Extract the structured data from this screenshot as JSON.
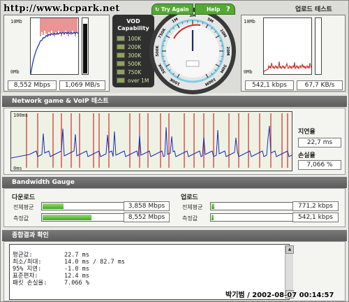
{
  "watermark": "http://www.bcpark.net",
  "download": {
    "graph_top": "10Mb",
    "graph_bottom": "0Mb",
    "speed": "8,552 Mbps",
    "rate": "1,069 MB/s"
  },
  "vod": {
    "title_1": "VOD",
    "title_2": "Capability",
    "items": [
      "100K",
      "200K",
      "300K",
      "500K",
      "750K",
      "over 1M"
    ],
    "active_count": 6
  },
  "gauge": {
    "try_again": "Try Again",
    "help": "Help",
    "help_glyph": "?",
    "scale": [
      "100K",
      "300K",
      "500K",
      "750K",
      "1M",
      "3M",
      "5M",
      "10M",
      "20M",
      "50M",
      "100M"
    ]
  },
  "upload": {
    "title": "업로드 테스트",
    "graph_top": "10Mb",
    "graph_bottom": "0Mb",
    "speed": "542,1 kbps",
    "rate": "67,7 KB/s"
  },
  "network": {
    "section_title": "Network game & VoIP 테스트",
    "axis_top": "100ms",
    "axis_bottom": "0ms",
    "latency_label": "지연율",
    "latency_value": "22,7 ms",
    "loss_label": "손실율",
    "loss_value": "7,066 %"
  },
  "bandwidth": {
    "section_title": "Bandwidth Gauge",
    "download": {
      "title": "다운로드",
      "avg_label": "전체평균",
      "avg_value": "3,858 Mbps",
      "avg_level": 0.26,
      "cur_label": "측정값",
      "cur_value": "8,552 Mbps",
      "cur_level": 0.58
    },
    "upload": {
      "title": "업로드",
      "avg_label": "전체평균",
      "avg_value": "771,2 kbps",
      "avg_level": 0.05,
      "cur_label": "측정값",
      "cur_value": "542,1 kbps",
      "cur_level": 0.04
    }
  },
  "result": {
    "section_title": "종합결과 확인",
    "lines": [
      {
        "key": "평균값:",
        "value": "22.7 ms"
      },
      {
        "key": "최소/최대:",
        "value": "14.0 ms / 82.7 ms"
      },
      {
        "key": "95% 지연:",
        "value": "-1.0 ms"
      },
      {
        "key": "표준편차:",
        "value": "12.4 ms"
      },
      {
        "key": "패킷 손실율:",
        "value": "7.066 %"
      }
    ]
  },
  "signature": "박기범 / 2002-08-07 00:14:57",
  "colors": {
    "accent_green": "#55a836",
    "gauge_needle": "#1a2a6a",
    "download_line": "#1b3fb0",
    "upload_line": "#c81e1e"
  }
}
